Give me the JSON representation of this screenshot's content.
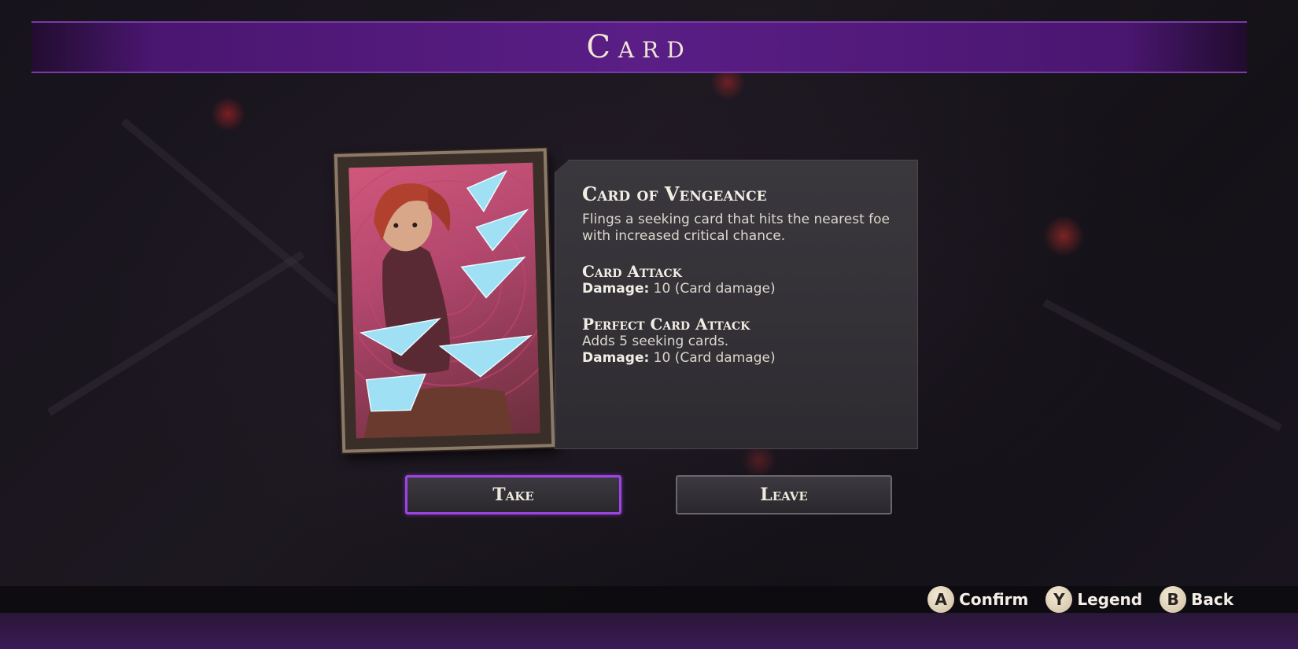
{
  "header": {
    "title": "Card"
  },
  "card": {
    "name": "Card of Vengeance",
    "description": "Flings a seeking card that hits the nearest foe with increased critical chance.",
    "attacks": [
      {
        "name": "Card Attack",
        "lines": [
          {
            "label": "Damage:",
            "value": " 10 (Card damage)"
          }
        ]
      },
      {
        "name": "Perfect Card Attack",
        "note": "Adds 5 seeking cards.",
        "lines": [
          {
            "label": "Damage:",
            "value": " 10 (Card damage)"
          }
        ]
      }
    ]
  },
  "buttons": {
    "take": "Take",
    "leave": "Leave"
  },
  "hints": [
    {
      "key": "A",
      "label": "Confirm"
    },
    {
      "key": "Y",
      "label": "Legend"
    },
    {
      "key": "B",
      "label": "Back"
    }
  ],
  "colors": {
    "accent": "#9d45e0",
    "title_bar": "#5a1e86",
    "panel": "#333136"
  },
  "selected_button": "take"
}
